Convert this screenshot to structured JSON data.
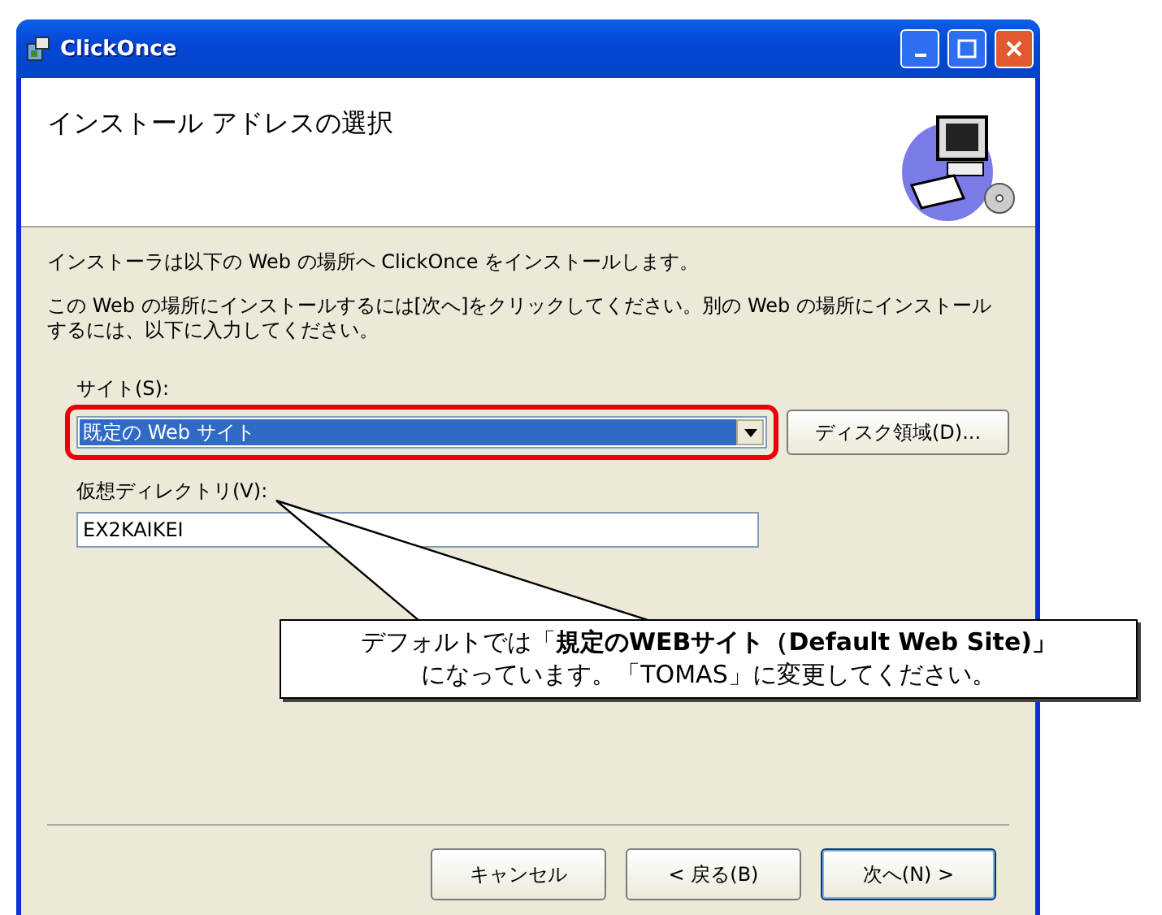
{
  "window": {
    "title": "ClickOnce"
  },
  "header": {
    "title": "インストール アドレスの選択"
  },
  "intro": "インストーラは以下の Web の場所へ ClickOnce をインストールします。",
  "instruction": "この Web の場所にインストールするには[次へ]をクリックしてください。別の Web の場所にインストールするには、以下に入力してください。",
  "site": {
    "label": "サイト(S):",
    "value": "既定の Web サイト"
  },
  "disk_button": "ディスク領域(D)...",
  "virtual_directory": {
    "label": "仮想ディレクトリ(V):",
    "value": "EX2KAIKEI"
  },
  "callout": {
    "lines": [
      "デフォルトでは「**規定のWEBサイト（Default Web Site)」**",
      "になっています。「TOMAS」に変更してください。"
    ]
  },
  "buttons": [
    {
      "label": "キャンセル",
      "default": false
    },
    {
      "label": "< 戻る(B)",
      "default": false
    },
    {
      "label": "次へ(N) >",
      "default": true
    }
  ]
}
